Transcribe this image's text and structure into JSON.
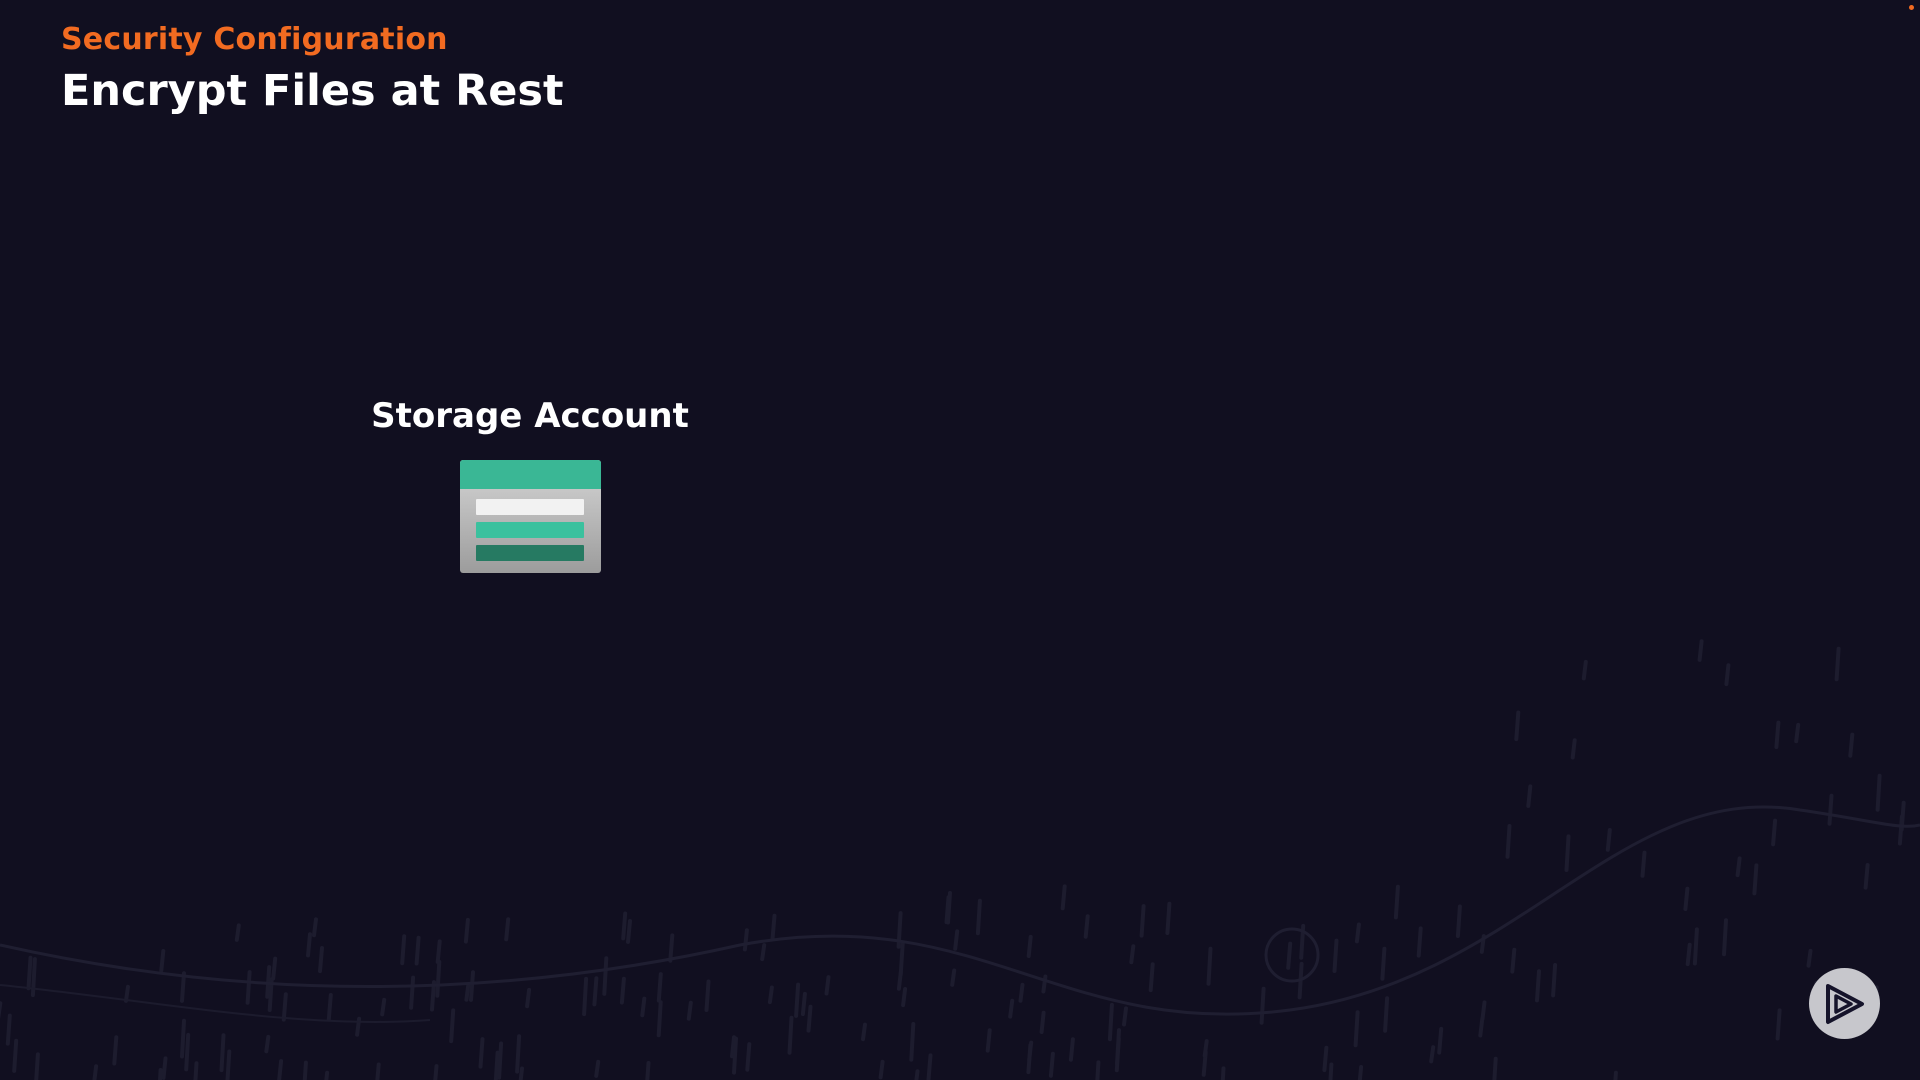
{
  "slide": {
    "eyebrow": "Security Configuration",
    "title": "Encrypt Files at Rest"
  },
  "diagram": {
    "node_label": "Storage Account",
    "node_icon": "storage-account-icon"
  },
  "branding": {
    "logo_icon": "play-logo-icon"
  },
  "colors": {
    "background": "#110f20",
    "accent": "#f26b21",
    "title": "#ffffff",
    "storage_top": "#3ab795",
    "storage_body": "#c4c4c4",
    "storage_row_light": "#f2f2f2",
    "storage_row_mid": "#3bc19e",
    "storage_row_dark": "#267a62",
    "logo_bg": "#c7c7cc"
  }
}
